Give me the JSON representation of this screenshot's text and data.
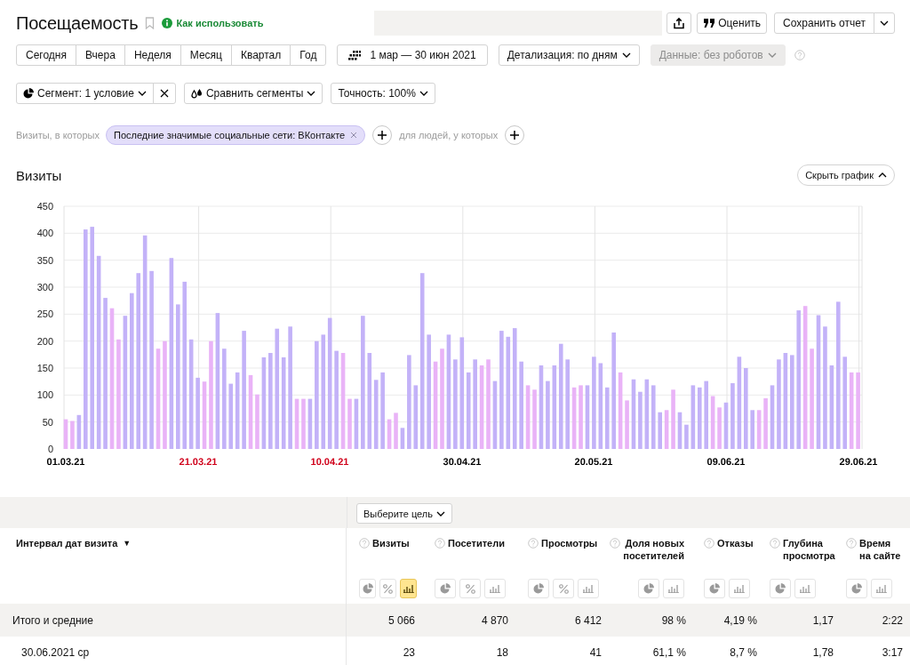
{
  "header": {
    "title": "Посещаемость",
    "help_link": "Как использовать",
    "actions": [
      {
        "kind": "share"
      },
      {
        "kind": "rate",
        "label": "Оценить"
      },
      {
        "kind": "save",
        "label": "Сохранить отчет"
      }
    ]
  },
  "periods": [
    "Сегодня",
    "Вчера",
    "Неделя",
    "Месяц",
    "Квартал",
    "Год"
  ],
  "date_range": "1 мар — 30 июн 2021",
  "detail": "Детализация: по дням",
  "data_filter": {
    "label": "Данные: без роботов",
    "disabled": true
  },
  "segment": "Сегмент: 1 условие",
  "compare": "Сравнить сегменты",
  "accuracy": "Точность: 100%",
  "filter": {
    "prefix": "Визиты, в которых",
    "chip": "Последние значимые социальные сети: ВКонтакте",
    "middle": "для людей, у которых"
  },
  "chart": {
    "title": "Визиты",
    "toggle": "Скрыть график",
    "chart_data": {
      "type": "bar",
      "stacked": true,
      "series": [
        {
          "color": "#c3b2f8",
          "values": [
            null,
            null,
            63,
            407,
            412,
            358,
            280,
            null,
            null,
            247,
            289,
            326,
            396,
            330,
            null,
            null,
            354,
            268,
            310,
            203,
            132,
            null,
            null,
            252,
            186,
            121,
            142,
            219,
            null,
            null,
            170,
            178,
            223,
            170,
            227,
            null,
            null,
            93,
            200,
            212,
            243,
            182,
            null,
            null,
            93,
            247,
            178,
            128,
            142,
            null,
            null,
            39,
            174,
            118,
            326,
            212,
            null,
            null,
            212,
            166,
            207,
            142,
            166,
            null,
            null,
            126,
            219,
            208,
            224,
            162,
            null,
            null,
            155,
            126,
            155,
            195,
            166,
            null,
            null,
            118,
            171,
            159,
            114,
            216,
            null,
            null,
            129,
            106,
            129,
            118,
            68,
            null,
            null,
            68,
            45,
            118,
            114,
            126,
            null,
            null,
            86,
            122,
            171,
            150,
            72,
            null,
            null,
            118,
            166,
            178,
            174,
            257,
            null,
            null,
            248,
            227,
            155,
            273,
            171,
            null,
            null
          ]
        },
        {
          "color": "#e9b3f7",
          "values": [
            55,
            52,
            null,
            null,
            null,
            null,
            null,
            261,
            203,
            null,
            null,
            null,
            null,
            null,
            186,
            200,
            null,
            null,
            null,
            null,
            null,
            125,
            200,
            null,
            null,
            null,
            null,
            null,
            137,
            101,
            null,
            null,
            null,
            null,
            null,
            93,
            93,
            null,
            null,
            null,
            null,
            null,
            178,
            93,
            null,
            null,
            null,
            null,
            null,
            55,
            67,
            null,
            null,
            null,
            null,
            null,
            162,
            186,
            null,
            null,
            null,
            null,
            null,
            155,
            166,
            null,
            null,
            null,
            null,
            null,
            118,
            110,
            null,
            null,
            null,
            null,
            null,
            114,
            118,
            null,
            null,
            null,
            null,
            null,
            142,
            90,
            null,
            null,
            null,
            null,
            null,
            72,
            110,
            null,
            null,
            null,
            null,
            null,
            98,
            77,
            null,
            null,
            null,
            null,
            null,
            72,
            94,
            null,
            null,
            null,
            null,
            null,
            265,
            186,
            null,
            null,
            null,
            null,
            null,
            142,
            142
          ]
        }
      ],
      "ylim": [
        0,
        450
      ],
      "yticks": [
        0,
        50,
        100,
        150,
        200,
        250,
        300,
        350,
        400,
        450
      ],
      "grid": true,
      "categories": [
        "01.03.21",
        null,
        null,
        null,
        null,
        null,
        null,
        null,
        null,
        null,
        null,
        null,
        null,
        null,
        null,
        null,
        null,
        null,
        null,
        null,
        "21.03.21",
        null,
        null,
        null,
        null,
        null,
        null,
        null,
        null,
        null,
        null,
        null,
        null,
        null,
        null,
        null,
        null,
        null,
        null,
        null,
        "10.04.21",
        null,
        null,
        null,
        null,
        null,
        null,
        null,
        null,
        null,
        null,
        null,
        null,
        null,
        null,
        null,
        null,
        null,
        null,
        null,
        "30.04.21",
        null,
        null,
        null,
        null,
        null,
        null,
        null,
        null,
        null,
        null,
        null,
        null,
        null,
        null,
        null,
        null,
        null,
        null,
        null,
        "20.05.21",
        null,
        null,
        null,
        null,
        null,
        null,
        null,
        null,
        null,
        null,
        null,
        null,
        null,
        null,
        null,
        null,
        null,
        null,
        null,
        "09.06.21",
        null,
        null,
        null,
        null,
        null,
        null,
        null,
        null,
        null,
        null,
        null,
        null,
        null,
        null,
        null,
        null,
        null,
        null,
        null,
        "29.06.21"
      ]
    },
    "x_labels": [
      {
        "color": "#000000"
      },
      {
        "color": "#d0021b"
      },
      {
        "color": "#d0021b"
      },
      {
        "color": "#000000"
      },
      {
        "color": "#000000"
      },
      {
        "color": "#000000"
      },
      {
        "color": "#000000"
      }
    ]
  },
  "table": {
    "goal_button": "Выберите цель",
    "first_column": {
      "label": "Интервал дат визита",
      "sort": "▼"
    },
    "columns": [
      {
        "label": "Визиты",
        "views": [
          {
            "kind": "pie",
            "selected": false
          },
          {
            "kind": "percent",
            "selected": false
          },
          {
            "kind": "bars",
            "selected": true
          }
        ]
      },
      {
        "label": "Посетители",
        "views": [
          {
            "kind": "pie",
            "selected": false
          },
          {
            "kind": "percent",
            "selected": false
          },
          {
            "kind": "bars",
            "selected": false
          }
        ]
      },
      {
        "label": "Просмотры",
        "views": [
          {
            "kind": "pie",
            "selected": false
          },
          {
            "kind": "percent",
            "selected": false
          },
          {
            "kind": "bars",
            "selected": false
          }
        ]
      },
      {
        "label": "Доля новых посетителей",
        "views": [
          {
            "kind": "pie",
            "selected": false
          },
          {
            "kind": "bars",
            "selected": false
          }
        ]
      },
      {
        "label": "Отказы",
        "views": [
          {
            "kind": "pie",
            "selected": false
          },
          {
            "kind": "bars",
            "selected": false
          }
        ]
      },
      {
        "label": "Глубина просмотра",
        "views": [
          {
            "kind": "pie",
            "selected": false
          },
          {
            "kind": "bars",
            "selected": false
          }
        ]
      },
      {
        "label": "Время на сайте",
        "views": [
          {
            "kind": "pie",
            "selected": false
          },
          {
            "kind": "bars",
            "selected": false
          }
        ]
      }
    ],
    "totals": {
      "label": "Итого и средние",
      "values": [
        "5 066",
        "4 870",
        "6 412",
        "98 %",
        "4,19 %",
        "1,17",
        "2:22"
      ]
    },
    "rows": [
      {
        "label": "30.06.2021 ср",
        "values": [
          "23",
          "18",
          "41",
          "61,1 %",
          "8,7 %",
          "1,78",
          "3:17"
        ]
      }
    ]
  }
}
